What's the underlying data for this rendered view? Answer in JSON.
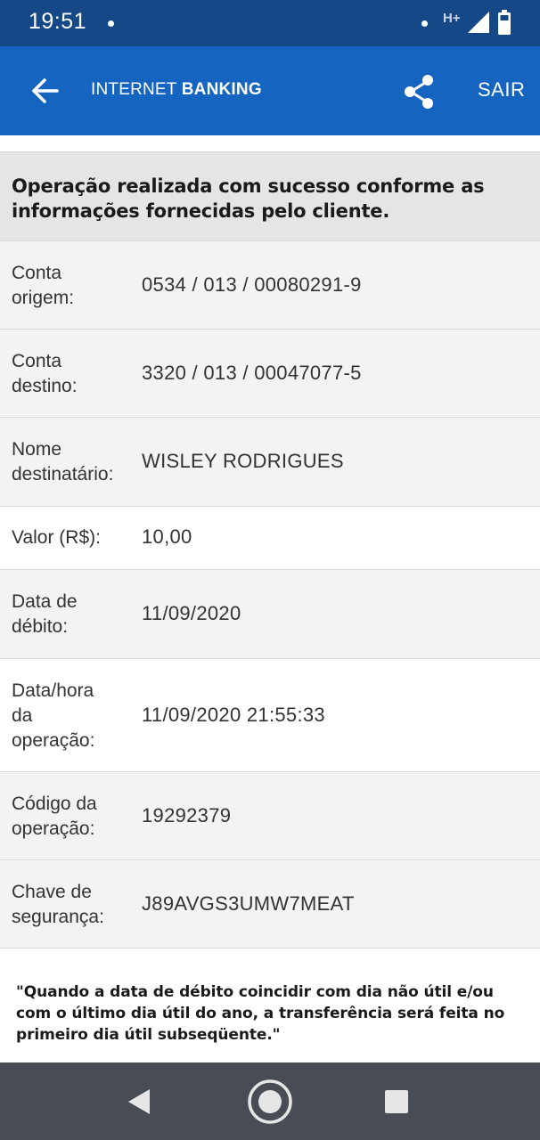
{
  "status_bar": {
    "time": "19:51",
    "network": "H+",
    "icons": [
      "notification-dot-icon",
      "signal-icon",
      "battery-icon"
    ]
  },
  "app_bar": {
    "back_icon": "arrow-left-icon",
    "title_light": "INTERNET ",
    "title_bold": "BANKING",
    "share_icon": "share-icon",
    "logout_label": "SAIR"
  },
  "banner": {
    "text": "Operação realizada com sucesso conforme as informações fornecidas pelo cliente."
  },
  "details": [
    {
      "label_lines": [
        "Conta",
        "origem:"
      ],
      "value": "0534 / 013 / 00080291-9"
    },
    {
      "label_lines": [
        "Conta",
        "destino:"
      ],
      "value": "3320 / 013 / 00047077-5"
    },
    {
      "label_lines": [
        "Nome",
        "destinatário:"
      ],
      "value": "WISLEY RODRIGUES"
    },
    {
      "label_lines": [
        "Valor (R$):"
      ],
      "value": "10,00"
    },
    {
      "label_lines": [
        "Data de",
        "débito:"
      ],
      "value": "11/09/2020"
    },
    {
      "label_lines": [
        "Data/hora",
        "da",
        "operação:"
      ],
      "value": "11/09/2020 21:55:33"
    },
    {
      "label_lines": [
        "Código da",
        "operação:"
      ],
      "value": "19292379"
    },
    {
      "label_lines": [
        "Chave de",
        "segurança:"
      ],
      "value": "J89AVGS3UMW7MEAT"
    }
  ],
  "notice": "\"Quando a data de débito coincidir com dia não útil e/ou com o último dia útil do ano, a transferência será feita no primeiro dia útil subseqüente.\"",
  "nav_bar": {
    "back": "triangle-back-icon",
    "home": "circle-home-icon",
    "recents": "square-recents-icon"
  },
  "colors": {
    "status_bar": "#154886",
    "app_bar": "#1565c0",
    "nav_bar": "#484c54",
    "banner_bg": "#e5e5e5",
    "row_alt": "#f4f2f2"
  }
}
